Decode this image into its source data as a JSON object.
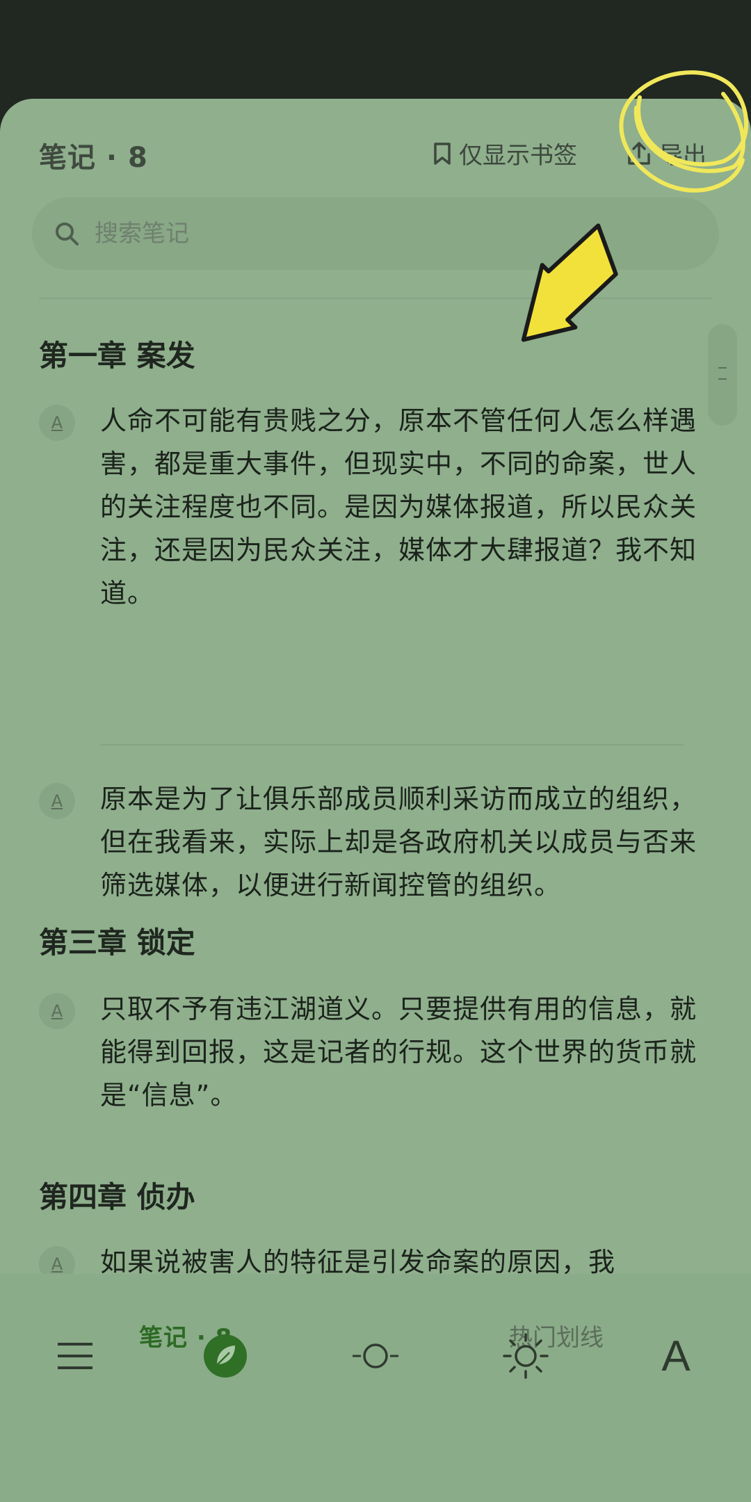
{
  "header": {
    "title": "笔记 · 8",
    "bookmark_filter_label": "仅显示书签",
    "export_label": "导出"
  },
  "search": {
    "placeholder": "搜索笔记"
  },
  "sections": [
    {
      "chapter": "第一章 案发",
      "notes": [
        {
          "badge": "A",
          "text": "人命不可能有贵贱之分，原本不管任何人怎么样遇害，都是重大事件，但现实中，不同的命案，世人的关注程度也不同。是因为媒体报道，所以民众关注，还是因为民众关注，媒体才大肆报道？我不知道。"
        },
        {
          "badge": "A",
          "text": "原本是为了让俱乐部成员顺利采访而成立的组织，但在我看来，实际上却是各政府机关以成员与否来筛选媒体，以便进行新闻控管的组织。"
        }
      ]
    },
    {
      "chapter": "第三章 锁定",
      "notes": [
        {
          "badge": "A",
          "text": "只取不予有违江湖道义。只要提供有用的信息，就能得到回报，这是记者的行规。这个世界的货币就是“信息”。"
        }
      ]
    },
    {
      "chapter": "第四章 侦办",
      "notes": [
        {
          "badge": "A",
          "text": "如果说被害人的特征是引发命案的原因，我"
        }
      ]
    }
  ],
  "bottom_tabs": {
    "notes_label": "笔记 · 8",
    "hot_label": "热门划线"
  },
  "toolbar": {
    "icons": [
      "menu-icon",
      "notes-leaf-icon",
      "progress-icon",
      "brightness-icon",
      "font-icon"
    ],
    "font_label": "A"
  },
  "colors": {
    "sheet_background": "#8faf8d",
    "top_bar": "#212721",
    "active_tab": "#2c6a24",
    "annotation_yellow": "#f0e85a"
  }
}
